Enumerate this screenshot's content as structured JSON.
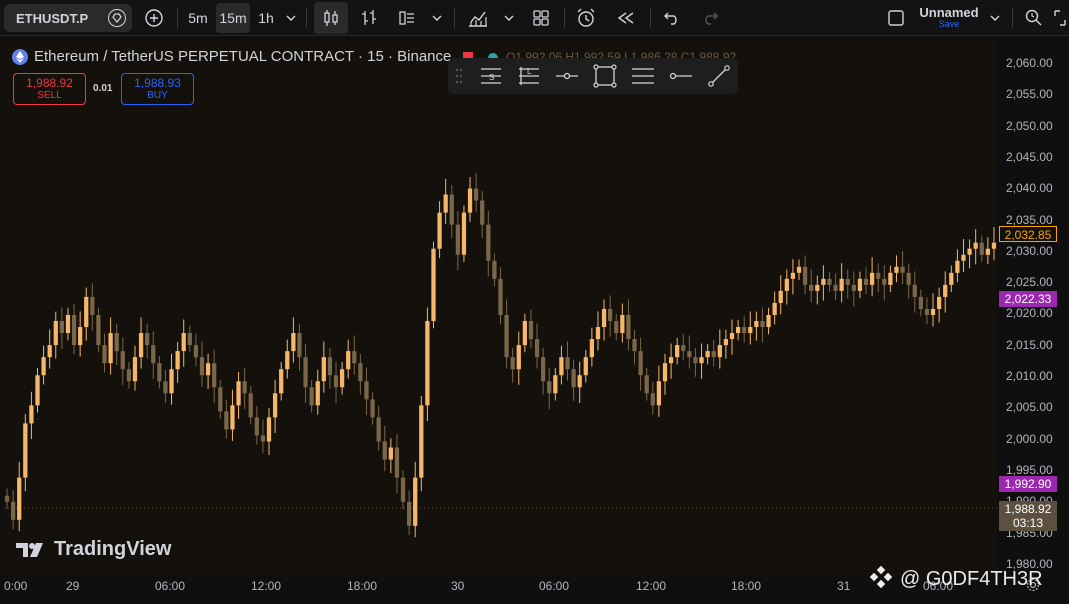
{
  "toolbar": {
    "symbol": "ETHUSDT.P",
    "timeframes": [
      "5m",
      "15m",
      "1h"
    ],
    "layout_name": "Unnamed",
    "save_label": "Save"
  },
  "legend": {
    "title": "Ethereum / TetherUS PERPETUAL CONTRACT · 15 · Binance",
    "ohlc": "O1,992.06 H1,992.59 L1,986.28 C1,988.92"
  },
  "trade": {
    "sell_price": "1,988.92",
    "sell_label": "SELL",
    "spread": "0.01",
    "buy_price": "1,988.93",
    "buy_label": "BUY"
  },
  "price_axis": {
    "ticks": [
      "2,060.00",
      "2,055.00",
      "2,050.00",
      "2,045.00",
      "2,040.00",
      "2,035.00",
      "2,030.00",
      "2,025.00",
      "2,020.00",
      "2,015.00",
      "2,010.00",
      "2,005.00",
      "2,000.00",
      "1,995.00",
      "1,990.00",
      "1,985.00",
      "1,980.00"
    ],
    "current_price": "2,032.85",
    "purple_label_1": "2,022.33",
    "purple_label_2": "1,992.90",
    "last_price": "1,988.92",
    "countdown": "03:13"
  },
  "time_axis": {
    "ticks": [
      "0:00",
      "29",
      "06:00",
      "12:00",
      "18:00",
      "30",
      "06:00",
      "12:00",
      "18:00",
      "31",
      "06:00"
    ]
  },
  "watermark": "TradingView",
  "overlay_mark": "@ G0DF4TH3R",
  "colors": {
    "candle_up": "#f7b76a",
    "candle_down": "#7a6649",
    "background": "#14100b",
    "accent": "#2962ff",
    "sell": "#f23645",
    "highlight": "#9c27b0"
  },
  "chart_data": {
    "type": "candlestick",
    "ylim": [
      1978,
      2063
    ],
    "closes": [
      1990,
      1987,
      1994,
      2003,
      2006,
      2011,
      2014,
      2016,
      2020,
      2018,
      2021,
      2016,
      2019,
      2024,
      2021,
      2016,
      2013,
      2018,
      2015,
      2012,
      2010,
      2014,
      2018,
      2016,
      2013,
      2010,
      2008,
      2012,
      2015,
      2018,
      2016,
      2014,
      2011,
      2013,
      2009,
      2005,
      2002,
      2006,
      2010,
      2008,
      2004,
      2001,
      2000,
      2004,
      2008,
      2012,
      2015,
      2018,
      2014,
      2009,
      2006,
      2010,
      2014,
      2011,
      2009,
      2012,
      2015,
      2013,
      2010,
      2007,
      2004,
      2000,
      1997,
      1999,
      1994,
      1990,
      1986,
      1994,
      2006,
      2020,
      2032,
      2038,
      2041,
      2036,
      2031,
      2038,
      2042,
      2040,
      2036,
      2030,
      2027,
      2021,
      2014,
      2012,
      2016,
      2020,
      2017,
      2014,
      2010,
      2008,
      2011,
      2014,
      2012,
      2009,
      2011,
      2014,
      2017,
      2019,
      2022,
      2020,
      2018,
      2021,
      2017,
      2015,
      2011,
      2008,
      2006,
      2010,
      2013,
      2014,
      2016,
      2015,
      2014,
      2013,
      2014,
      2015,
      2014,
      2016,
      2017,
      2018,
      2019,
      2018,
      2019,
      2020,
      2019,
      2021,
      2023,
      2025,
      2027,
      2028,
      2029,
      2026,
      2025,
      2026,
      2027,
      2026,
      2025,
      2027,
      2026,
      2025,
      2027,
      2026,
      2028,
      2027,
      2026,
      2028,
      2029,
      2028,
      2026,
      2024,
      2022,
      2021,
      2022,
      2024,
      2026,
      2028,
      2030,
      2031,
      2032,
      2033,
      2031,
      2032,
      2033
    ]
  }
}
